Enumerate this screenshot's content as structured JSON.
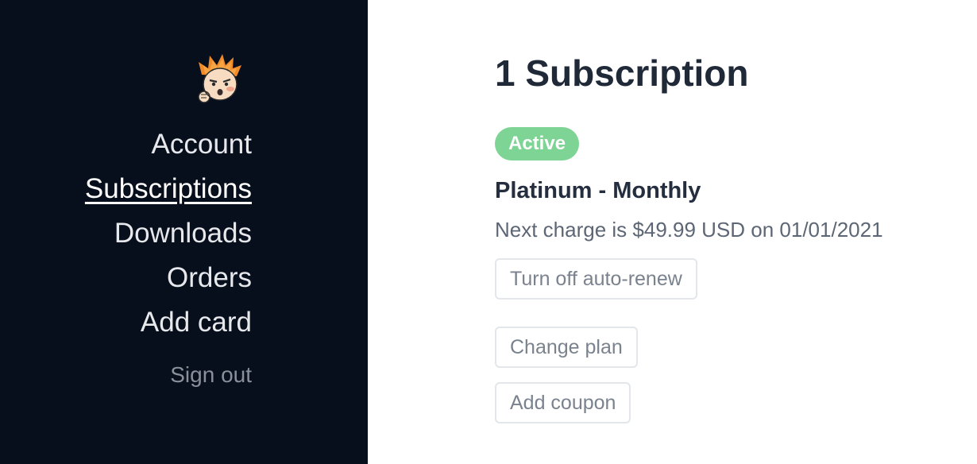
{
  "sidebar": {
    "avatar_icon": "cartoon-avatar-icon",
    "nav": [
      {
        "label": "Account",
        "active": false
      },
      {
        "label": "Subscriptions",
        "active": true
      },
      {
        "label": "Downloads",
        "active": false
      },
      {
        "label": "Orders",
        "active": false
      },
      {
        "label": "Add card",
        "active": false
      }
    ],
    "sign_out": "Sign out"
  },
  "main": {
    "title": "1 Subscription",
    "subscription": {
      "status": "Active",
      "plan": "Platinum - Monthly",
      "next_charge": "Next charge is $49.99 USD on 01/01/2021"
    },
    "buttons": {
      "auto_renew": "Turn off auto-renew",
      "change_plan": "Change plan",
      "add_coupon": "Add coupon"
    }
  },
  "colors": {
    "sidebar_bg": "#070f1c",
    "status_active": "#7dd494",
    "title_text": "#1f2937"
  }
}
